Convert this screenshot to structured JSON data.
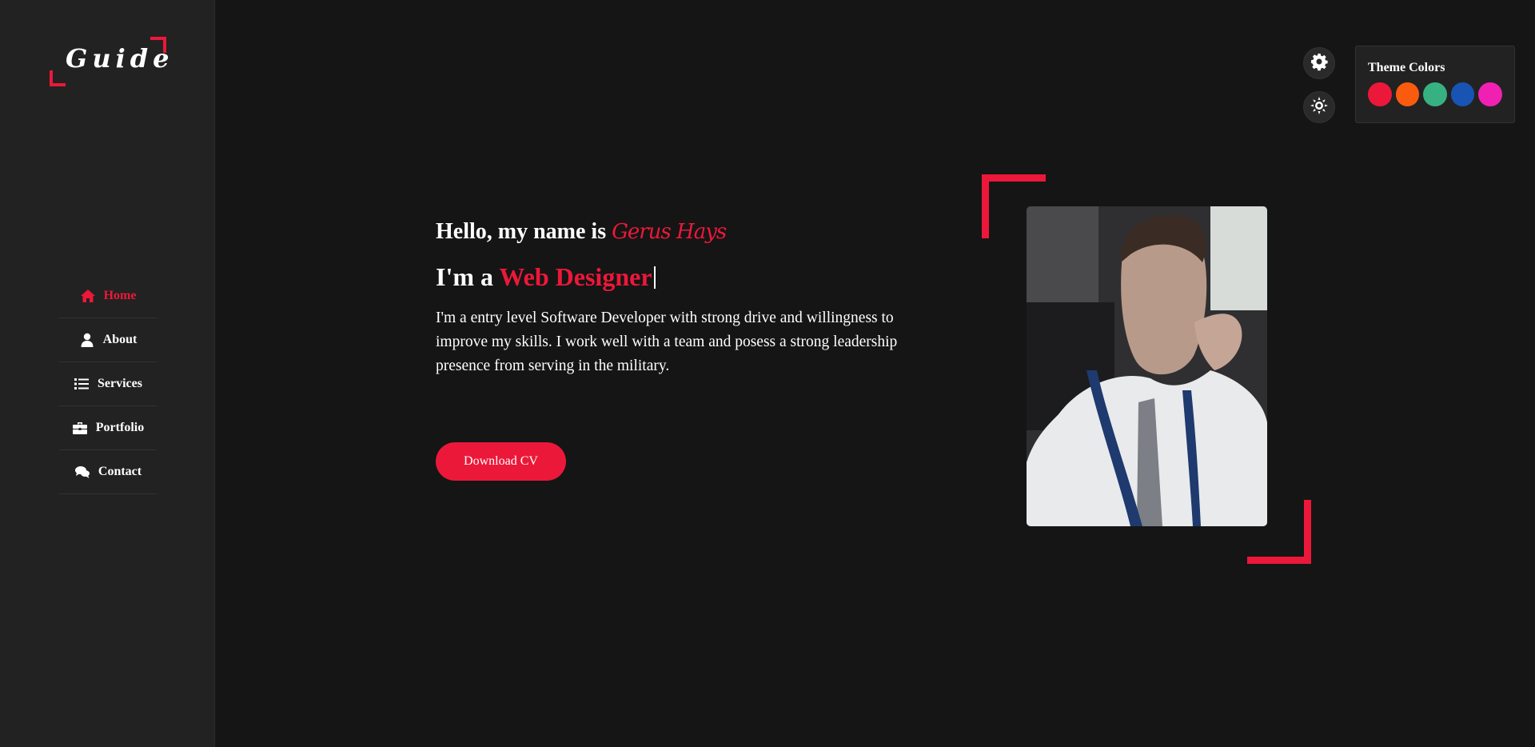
{
  "logo": {
    "text": "Guide"
  },
  "nav": [
    {
      "label": "Home",
      "icon": "home-icon",
      "active": true
    },
    {
      "label": "About",
      "icon": "user-icon",
      "active": false
    },
    {
      "label": "Services",
      "icon": "list-icon",
      "active": false
    },
    {
      "label": "Portfolio",
      "icon": "briefcase-icon",
      "active": false
    },
    {
      "label": "Contact",
      "icon": "comments-icon",
      "active": false
    }
  ],
  "hero": {
    "greeting": "Hello, my name is ",
    "name": "Gerus Hays",
    "role_prefix": "I'm a ",
    "role_typed": "Web Designer",
    "bio": "I'm a entry level Software Developer with strong drive and willingness to improve my skills. I work well with a team and posess a strong leadership presence from serving in the military.",
    "button": "Download CV"
  },
  "style_switcher": {
    "gear_icon": "gear-icon",
    "theme_toggle_icon": "sun-icon",
    "title": "Theme Colors",
    "colors": [
      "#ec1839",
      "#fa5b0f",
      "#37b182",
      "#1854b4",
      "#f021b2"
    ]
  },
  "accent_color": "#ec1839"
}
